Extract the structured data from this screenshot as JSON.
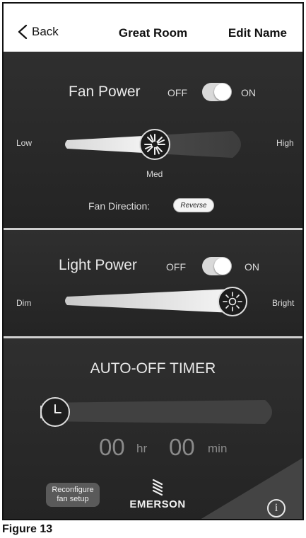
{
  "header": {
    "back_label": "Back",
    "title": "Great Room",
    "edit_label": "Edit Name"
  },
  "fan": {
    "title": "Fan Power",
    "off_label": "OFF",
    "on_label": "ON",
    "power_on": true,
    "speed_low_label": "Low",
    "speed_high_label": "High",
    "speed_value_label": "Med",
    "direction_label": "Fan Direction:",
    "direction_button": "Reverse"
  },
  "light": {
    "title": "Light Power",
    "off_label": "OFF",
    "on_label": "ON",
    "power_on": true,
    "dim_label": "Dim",
    "bright_label": "Bright",
    "brightness_level": 1.0
  },
  "timer": {
    "title": "AUTO-OFF TIMER",
    "hours": "00",
    "hours_unit": "hr",
    "minutes": "00",
    "minutes_unit": "min"
  },
  "footer": {
    "reconfigure_line1": "Reconfigure",
    "reconfigure_line2": "fan setup",
    "brand": "EMERSON",
    "info_symbol": "i"
  },
  "caption": "Figure 13",
  "icons": {
    "back": "chevron-left-icon",
    "fan_knob": "fan-icon",
    "light_knob": "sun-icon",
    "timer_knob": "clock-icon",
    "info": "info-icon",
    "brand": "emerson-logo"
  },
  "colors": {
    "panel_bg": "#2b2b2b",
    "divider": "#cfcfcf",
    "toggle_on": "#d9d9d9",
    "timer_digits": "#8a8a8a"
  }
}
